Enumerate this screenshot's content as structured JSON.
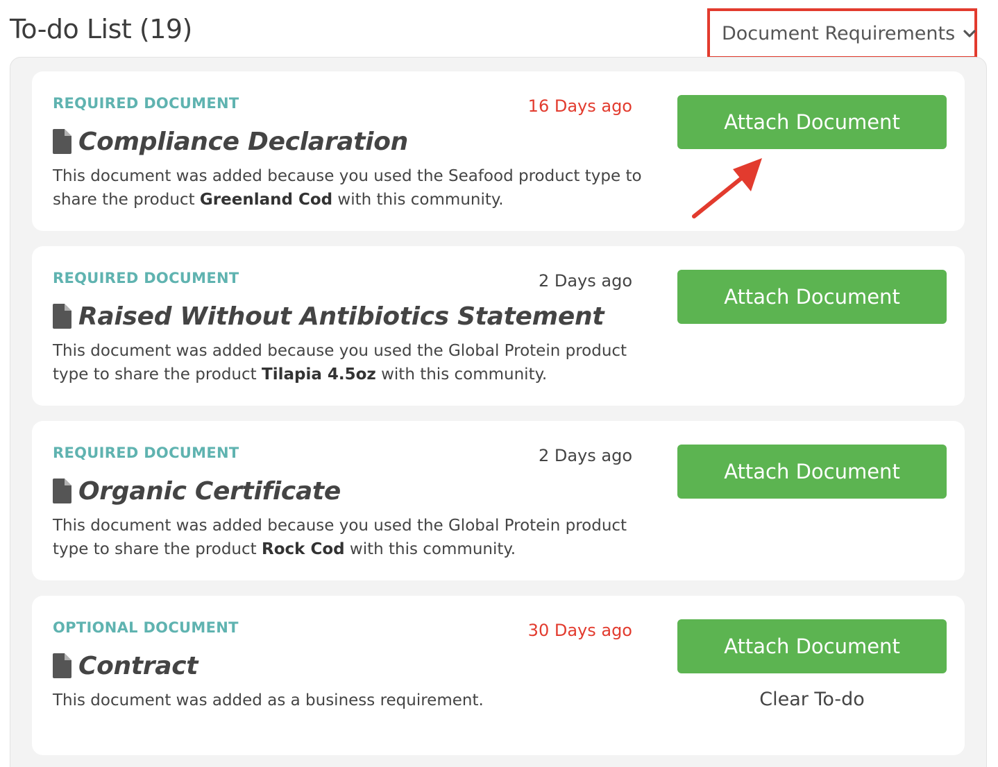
{
  "header": {
    "title": "To-do List (19)"
  },
  "filter": {
    "selected": "Document Requirements",
    "icon": "chevron-down-icon"
  },
  "colors": {
    "accent_teal": "#5fb3b0",
    "attach_green": "#5cb451",
    "overdue_red": "#e23b2e",
    "annotation_red": "#e23b2e"
  },
  "todos": [
    {
      "badge": "REQUIRED DOCUMENT",
      "age": "16 Days ago",
      "overdue": true,
      "title": "Compliance Declaration",
      "desc_pre": "This document was added because you used the Seafood product type to share the product ",
      "desc_bold": "Greenland Cod",
      "desc_post": " with this community.",
      "button": "Attach Document"
    },
    {
      "badge": "REQUIRED DOCUMENT",
      "age": "2 Days ago",
      "overdue": false,
      "title": "Raised Without Antibiotics Statement",
      "desc_pre": "This document was added because you used the Global Protein product type to share the product ",
      "desc_bold": "Tilapia 4.5oz",
      "desc_post": " with this community.",
      "button": "Attach Document"
    },
    {
      "badge": "REQUIRED DOCUMENT",
      "age": "2 Days ago",
      "overdue": false,
      "title": "Organic Certificate",
      "desc_pre": "This document was added because you used the Global Protein product type to share the product ",
      "desc_bold": "Rock Cod",
      "desc_post": " with this community.",
      "button": "Attach Document"
    },
    {
      "badge": "OPTIONAL DOCUMENT",
      "age": "30 Days ago",
      "overdue": true,
      "title": "Contract",
      "desc_pre": "This document was added as a business requirement.",
      "desc_bold": "",
      "desc_post": "",
      "button": "Attach Document",
      "clear": "Clear To-do"
    }
  ]
}
